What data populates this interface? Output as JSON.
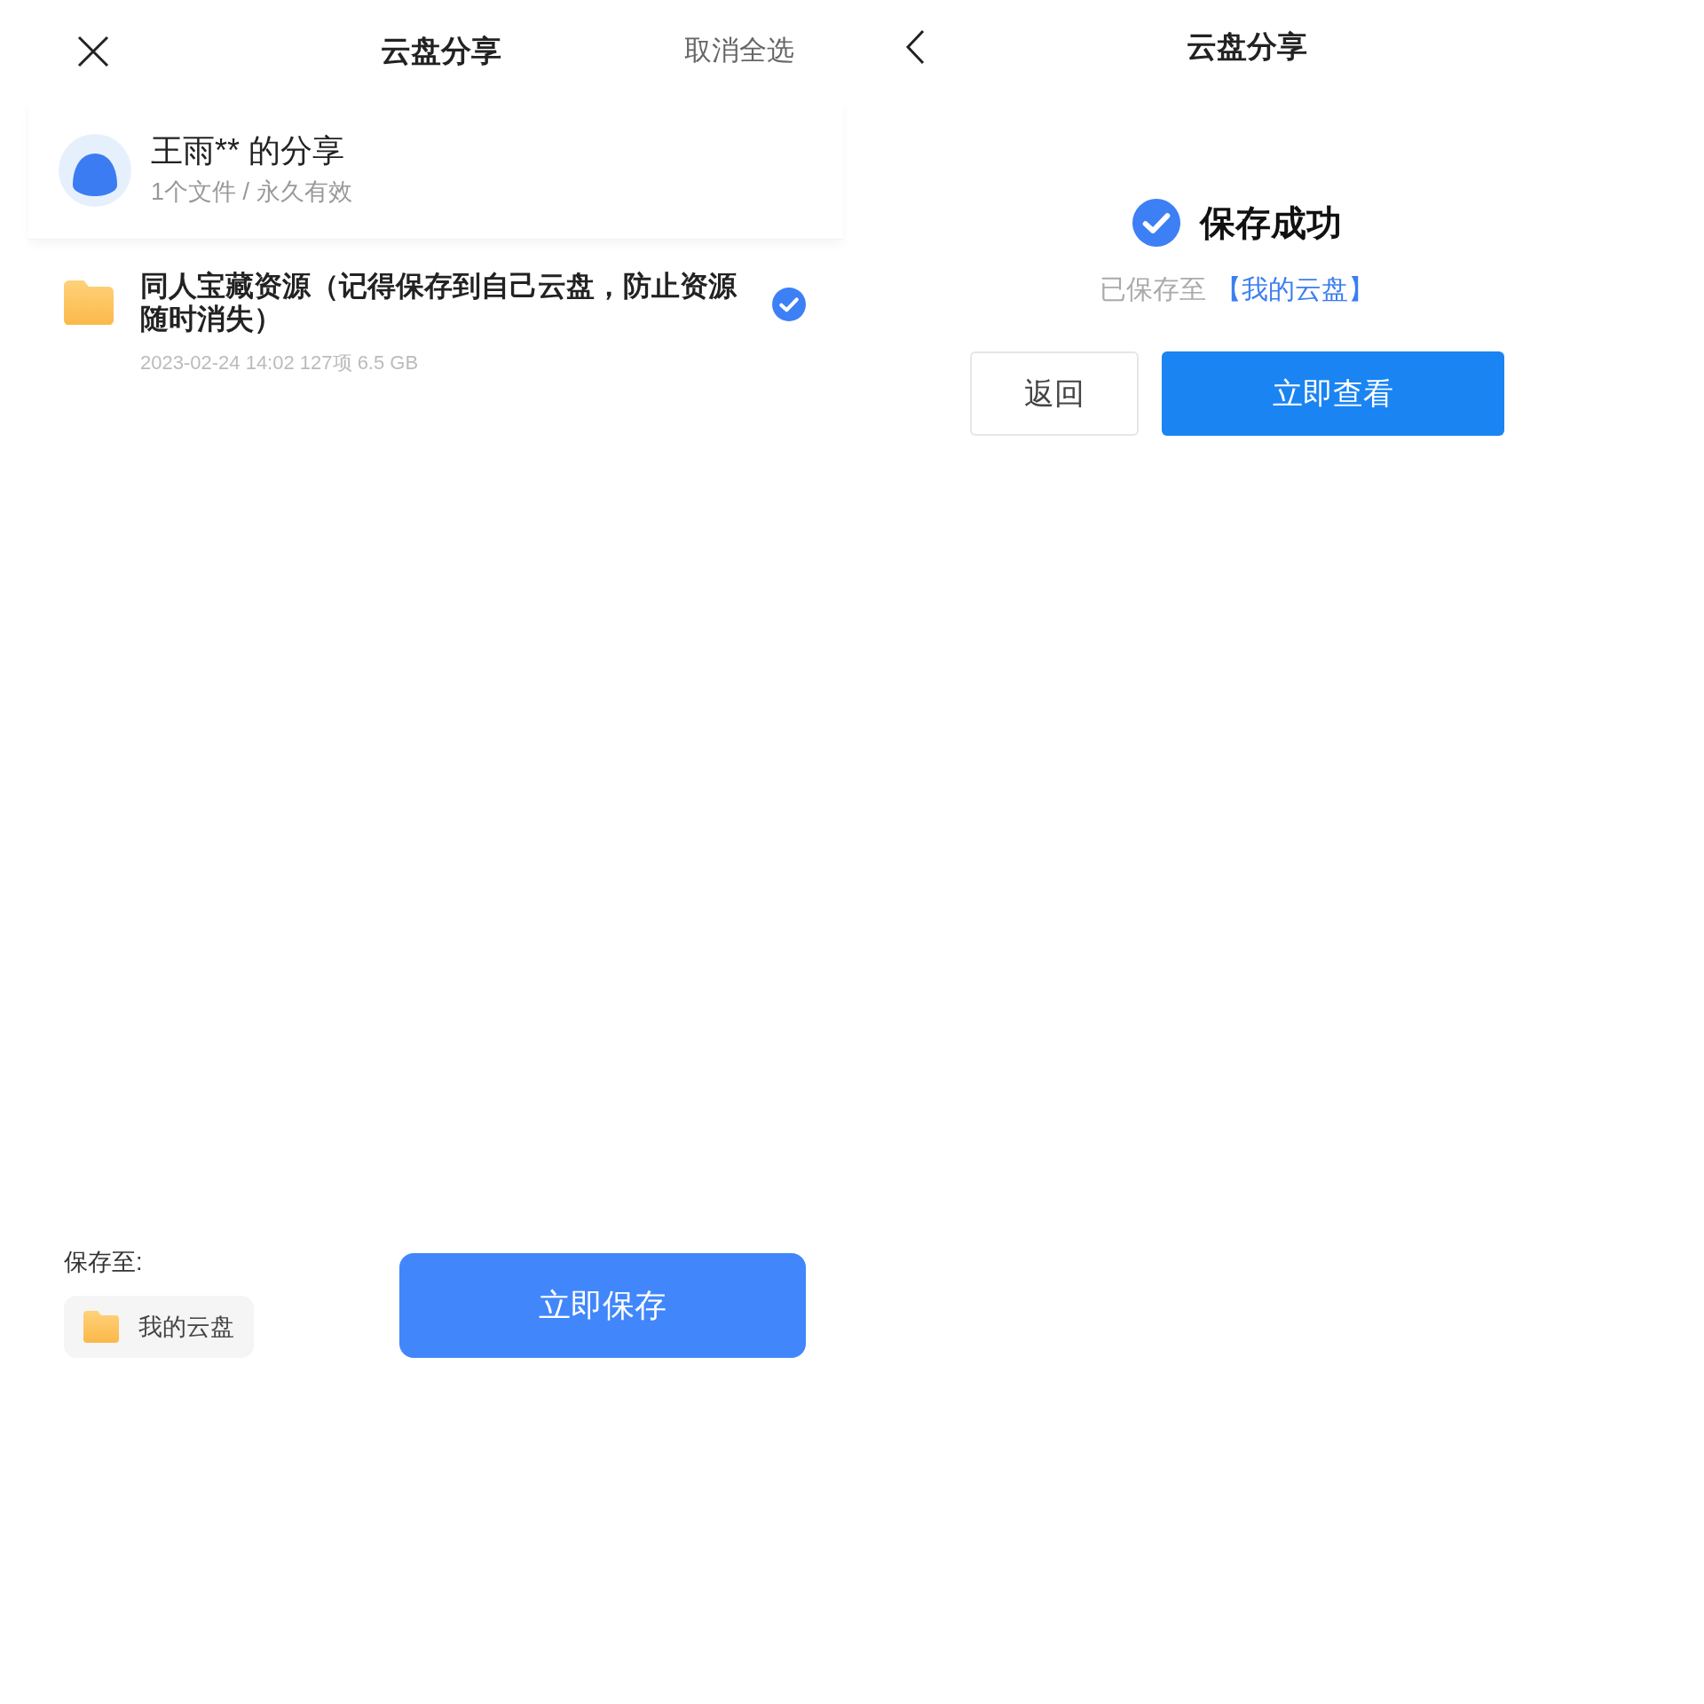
{
  "share_screen": {
    "title": "云盘分享",
    "header_action": "取消全选",
    "sharer": {
      "name": "王雨** 的分享",
      "summary": "1个文件 / 永久有效"
    },
    "files": [
      {
        "name": "同人宝藏资源（记得保存到自己云盘，防止资源随时消失）",
        "meta": "2023-02-24 14:02 127项 6.5 GB",
        "selected": true
      }
    ],
    "save_to_label": "保存至:",
    "save_to_folder": "我的云盘",
    "save_button": "立即保存"
  },
  "success_screen": {
    "title": "云盘分享",
    "message": "保存成功",
    "saved_to_prefix": "已保存至",
    "saved_to_link": "【我的云盘】",
    "back_button": "返回",
    "view_button": "立即查看"
  }
}
